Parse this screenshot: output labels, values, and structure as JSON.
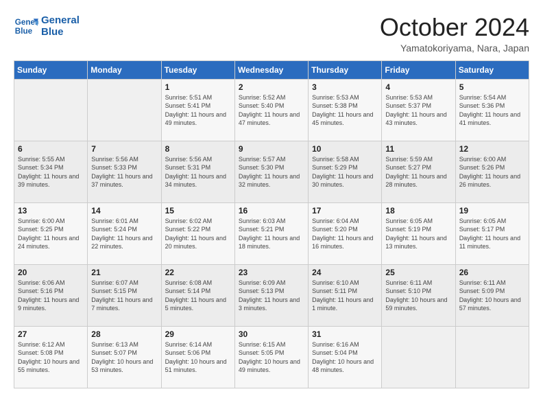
{
  "logo": {
    "line1": "General",
    "line2": "Blue"
  },
  "title": "October 2024",
  "location": "Yamatokoriyama, Nara, Japan",
  "headers": [
    "Sunday",
    "Monday",
    "Tuesday",
    "Wednesday",
    "Thursday",
    "Friday",
    "Saturday"
  ],
  "weeks": [
    [
      {
        "day": "",
        "info": ""
      },
      {
        "day": "",
        "info": ""
      },
      {
        "day": "1",
        "info": "Sunrise: 5:51 AM\nSunset: 5:41 PM\nDaylight: 11 hours and 49 minutes."
      },
      {
        "day": "2",
        "info": "Sunrise: 5:52 AM\nSunset: 5:40 PM\nDaylight: 11 hours and 47 minutes."
      },
      {
        "day": "3",
        "info": "Sunrise: 5:53 AM\nSunset: 5:38 PM\nDaylight: 11 hours and 45 minutes."
      },
      {
        "day": "4",
        "info": "Sunrise: 5:53 AM\nSunset: 5:37 PM\nDaylight: 11 hours and 43 minutes."
      },
      {
        "day": "5",
        "info": "Sunrise: 5:54 AM\nSunset: 5:36 PM\nDaylight: 11 hours and 41 minutes."
      }
    ],
    [
      {
        "day": "6",
        "info": "Sunrise: 5:55 AM\nSunset: 5:34 PM\nDaylight: 11 hours and 39 minutes."
      },
      {
        "day": "7",
        "info": "Sunrise: 5:56 AM\nSunset: 5:33 PM\nDaylight: 11 hours and 37 minutes."
      },
      {
        "day": "8",
        "info": "Sunrise: 5:56 AM\nSunset: 5:31 PM\nDaylight: 11 hours and 34 minutes."
      },
      {
        "day": "9",
        "info": "Sunrise: 5:57 AM\nSunset: 5:30 PM\nDaylight: 11 hours and 32 minutes."
      },
      {
        "day": "10",
        "info": "Sunrise: 5:58 AM\nSunset: 5:29 PM\nDaylight: 11 hours and 30 minutes."
      },
      {
        "day": "11",
        "info": "Sunrise: 5:59 AM\nSunset: 5:27 PM\nDaylight: 11 hours and 28 minutes."
      },
      {
        "day": "12",
        "info": "Sunrise: 6:00 AM\nSunset: 5:26 PM\nDaylight: 11 hours and 26 minutes."
      }
    ],
    [
      {
        "day": "13",
        "info": "Sunrise: 6:00 AM\nSunset: 5:25 PM\nDaylight: 11 hours and 24 minutes."
      },
      {
        "day": "14",
        "info": "Sunrise: 6:01 AM\nSunset: 5:24 PM\nDaylight: 11 hours and 22 minutes."
      },
      {
        "day": "15",
        "info": "Sunrise: 6:02 AM\nSunset: 5:22 PM\nDaylight: 11 hours and 20 minutes."
      },
      {
        "day": "16",
        "info": "Sunrise: 6:03 AM\nSunset: 5:21 PM\nDaylight: 11 hours and 18 minutes."
      },
      {
        "day": "17",
        "info": "Sunrise: 6:04 AM\nSunset: 5:20 PM\nDaylight: 11 hours and 16 minutes."
      },
      {
        "day": "18",
        "info": "Sunrise: 6:05 AM\nSunset: 5:19 PM\nDaylight: 11 hours and 13 minutes."
      },
      {
        "day": "19",
        "info": "Sunrise: 6:05 AM\nSunset: 5:17 PM\nDaylight: 11 hours and 11 minutes."
      }
    ],
    [
      {
        "day": "20",
        "info": "Sunrise: 6:06 AM\nSunset: 5:16 PM\nDaylight: 11 hours and 9 minutes."
      },
      {
        "day": "21",
        "info": "Sunrise: 6:07 AM\nSunset: 5:15 PM\nDaylight: 11 hours and 7 minutes."
      },
      {
        "day": "22",
        "info": "Sunrise: 6:08 AM\nSunset: 5:14 PM\nDaylight: 11 hours and 5 minutes."
      },
      {
        "day": "23",
        "info": "Sunrise: 6:09 AM\nSunset: 5:13 PM\nDaylight: 11 hours and 3 minutes."
      },
      {
        "day": "24",
        "info": "Sunrise: 6:10 AM\nSunset: 5:11 PM\nDaylight: 11 hours and 1 minute."
      },
      {
        "day": "25",
        "info": "Sunrise: 6:11 AM\nSunset: 5:10 PM\nDaylight: 10 hours and 59 minutes."
      },
      {
        "day": "26",
        "info": "Sunrise: 6:11 AM\nSunset: 5:09 PM\nDaylight: 10 hours and 57 minutes."
      }
    ],
    [
      {
        "day": "27",
        "info": "Sunrise: 6:12 AM\nSunset: 5:08 PM\nDaylight: 10 hours and 55 minutes."
      },
      {
        "day": "28",
        "info": "Sunrise: 6:13 AM\nSunset: 5:07 PM\nDaylight: 10 hours and 53 minutes."
      },
      {
        "day": "29",
        "info": "Sunrise: 6:14 AM\nSunset: 5:06 PM\nDaylight: 10 hours and 51 minutes."
      },
      {
        "day": "30",
        "info": "Sunrise: 6:15 AM\nSunset: 5:05 PM\nDaylight: 10 hours and 49 minutes."
      },
      {
        "day": "31",
        "info": "Sunrise: 6:16 AM\nSunset: 5:04 PM\nDaylight: 10 hours and 48 minutes."
      },
      {
        "day": "",
        "info": ""
      },
      {
        "day": "",
        "info": ""
      }
    ]
  ]
}
